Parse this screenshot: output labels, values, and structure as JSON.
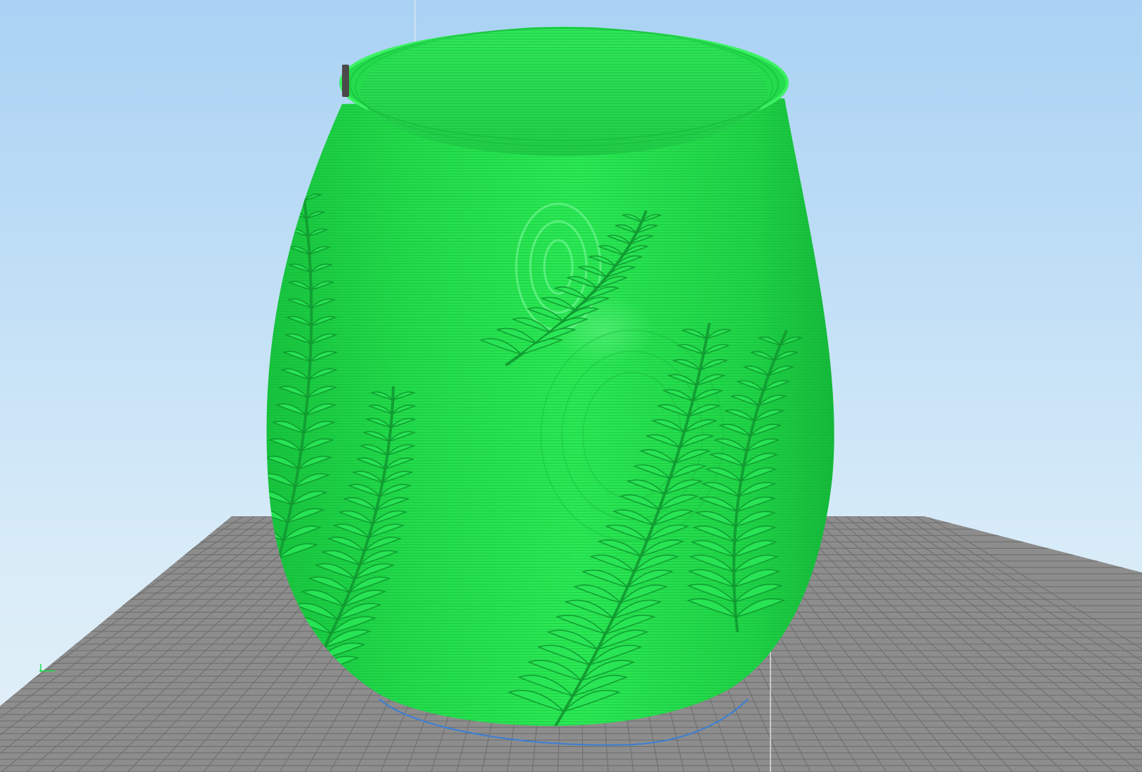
{
  "viewport": {
    "kind": "3d-gcode-preview",
    "background_top": "#a9d2f4",
    "background_bottom": "#e3f0f9"
  },
  "bed": {
    "plate_color": "#8c8c8c",
    "grid_color": "#6f6f6f"
  },
  "model": {
    "object": "vase",
    "decoration": "fern-leaves",
    "toolpath_color": "#1fe04a",
    "toolpath_highlight": "#6cf78a",
    "toolpath_shadow": "#13b535"
  },
  "skirt": {
    "color": "#3a7fd6"
  },
  "nozzle": {
    "color": "#4a4a4a"
  }
}
